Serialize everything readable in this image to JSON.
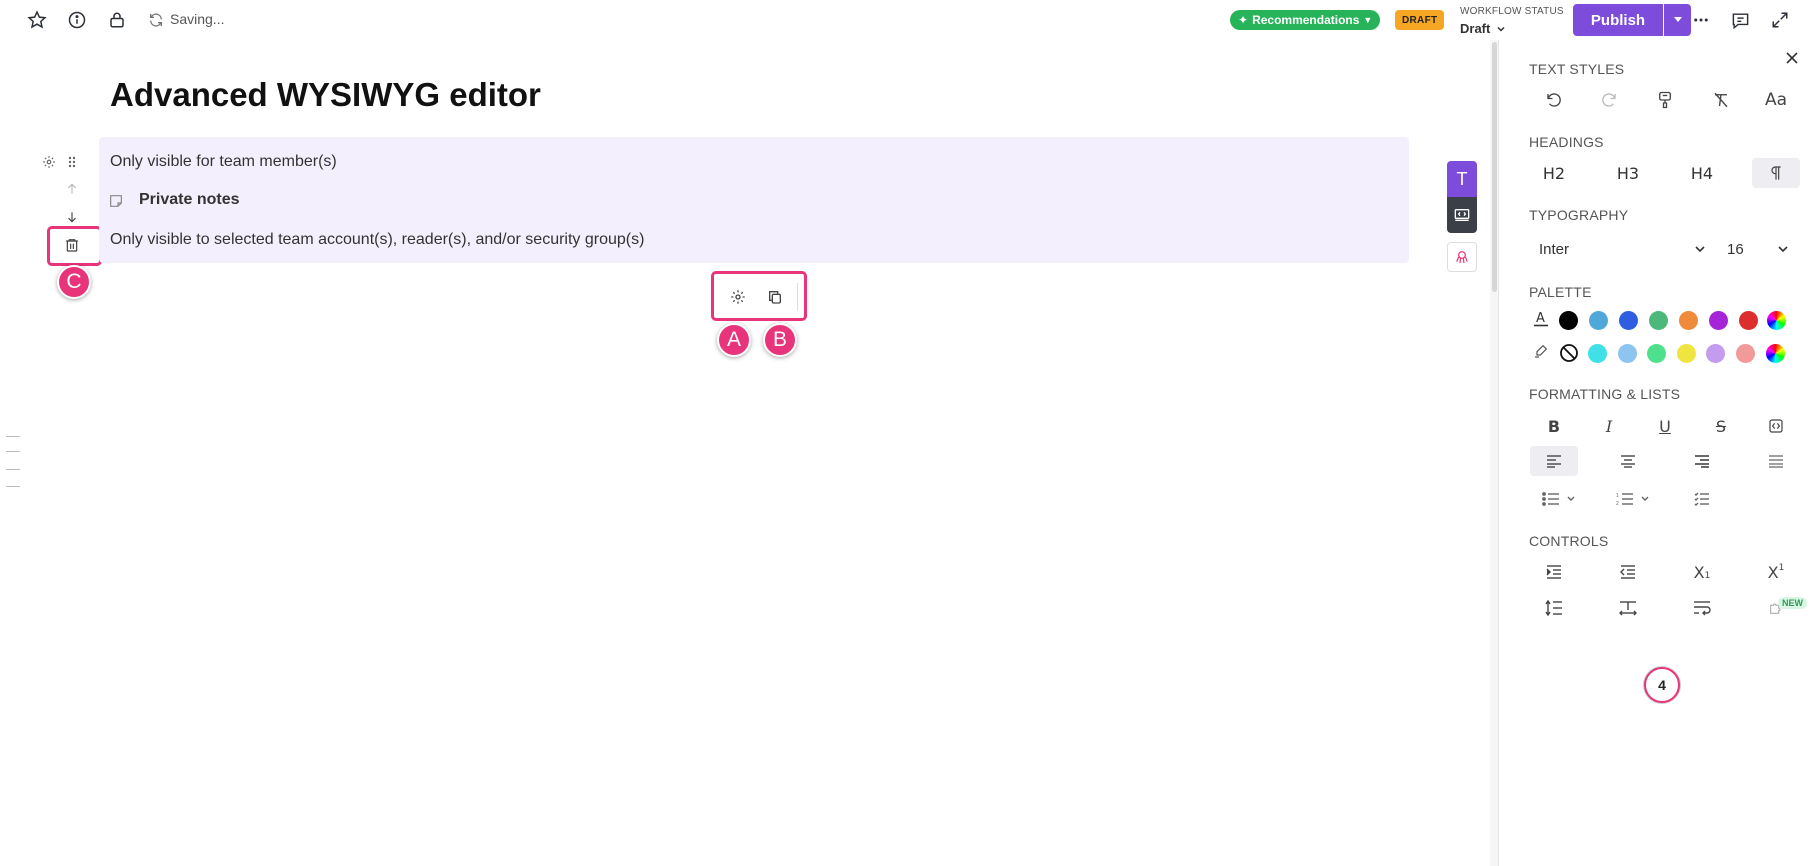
{
  "topbar": {
    "saving": "Saving...",
    "recommendations": "Recommendations",
    "status_badge": "DRAFT",
    "workflow_label": "WORKFLOW STATUS",
    "workflow_value": "Draft",
    "publish": "Publish"
  },
  "editor": {
    "title": "Advanced WYSIWYG editor",
    "block": {
      "line1": "Only visible for team member(s)",
      "private_notes": "Private notes",
      "line3": "Only visible to selected team account(s), reader(s), and/or security group(s)"
    },
    "callouts": {
      "a": "A",
      "b": "B",
      "c": "C"
    }
  },
  "panel": {
    "text_styles": "TEXT STYLES",
    "text_styles_buttons": [
      "undo-icon",
      "redo-icon",
      "format-painter-icon",
      "clear-format-icon",
      "font-case-icon"
    ],
    "headings": "HEADINGS",
    "heading_buttons": [
      "H2",
      "H3",
      "H4"
    ],
    "typography": "TYPOGRAPHY",
    "font_family": "Inter",
    "font_size": "16",
    "palette": "PALETTE",
    "text_colors": [
      "#000000",
      "#4fa8d8",
      "#2f5fe0",
      "#4cb87a",
      "#ee8a3a",
      "#a524d8",
      "#dd2e2e"
    ],
    "highlight_colors": [
      "#3fe0e8",
      "#8ec4f0",
      "#4fe08e",
      "#f0e440",
      "#c49cee",
      "#f29a9a"
    ],
    "formatting": "FORMATTING & LISTS",
    "controls": "CONTROLS",
    "new_badge": "NEW",
    "step_number": "4"
  }
}
